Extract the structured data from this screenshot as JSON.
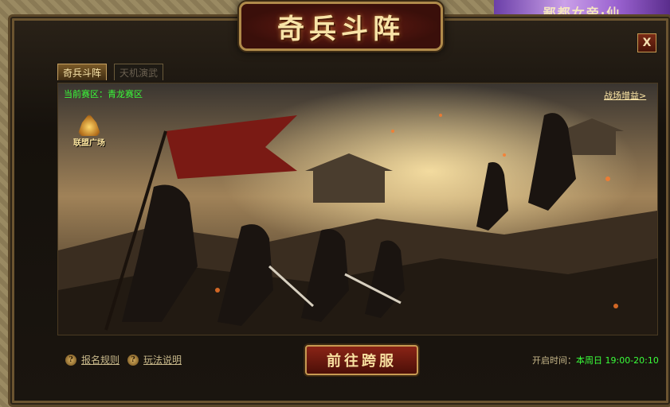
{
  "banner": {
    "text": "鄙都女帝·仙"
  },
  "window": {
    "title": "奇兵斗阵",
    "close_label": "X"
  },
  "tabs": [
    {
      "label": "奇兵斗阵",
      "active": true
    },
    {
      "label": "天机演武",
      "active": false
    }
  ],
  "scene": {
    "region_prefix": "当前赛区：",
    "region_name": "青龙赛区",
    "buff_link": "战场增益>",
    "alliance_badge": "联盟广场"
  },
  "footer": {
    "rules_label": "报名规则",
    "guide_label": "玩法说明",
    "go_button": "前往跨服",
    "open_time_label": "开启时间：",
    "open_time_value": "本周日 19:00-20:10"
  },
  "colors": {
    "accent_green": "#3aff3a",
    "gold": "#c89a52",
    "button_red": "#8a2416"
  }
}
